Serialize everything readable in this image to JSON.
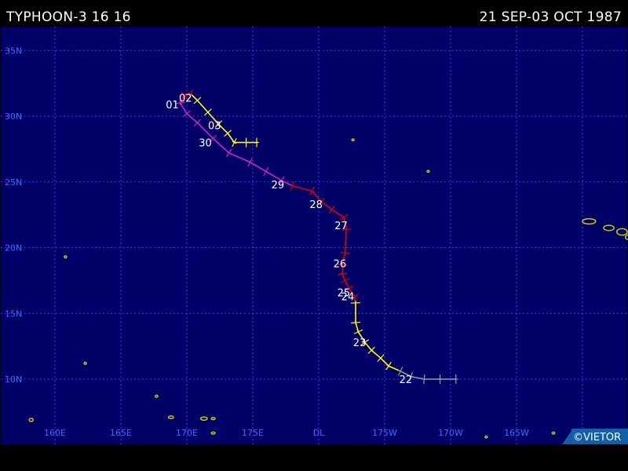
{
  "header": {
    "title": "TYPHOON-3 16 16",
    "dates": "21 SEP-03 OCT 1987"
  },
  "credit": "©VIETOR",
  "lat_labels": [
    {
      "lat": 35,
      "label": "35N"
    },
    {
      "lat": 30,
      "label": "30N"
    },
    {
      "lat": 25,
      "label": "25N"
    },
    {
      "lat": 20,
      "label": "20N"
    },
    {
      "lat": 15,
      "label": "15N"
    },
    {
      "lat": 10,
      "label": "10N"
    }
  ],
  "lon_labels": [
    {
      "lon": 160,
      "label": "160E"
    },
    {
      "lon": 165,
      "label": "165E"
    },
    {
      "lon": 170,
      "label": "170E"
    },
    {
      "lon": 175,
      "label": "175E"
    },
    {
      "lon": 180,
      "label": "DL"
    },
    {
      "lon": 185,
      "label": "175W"
    },
    {
      "lon": 190,
      "label": "170W"
    },
    {
      "lon": 195,
      "label": "165W"
    },
    {
      "lon": 200,
      "label": "160W"
    }
  ],
  "colors": {
    "ocean": "#000066",
    "grid": "#3a3aff",
    "axis_label": "#3b6dff",
    "depression": "#9a9a9a",
    "storm": "#ffff00",
    "typhoon": "#dd0000",
    "extratropical": "#cc22cc",
    "land": "#c8c800",
    "label": "#ffffff"
  },
  "track": [
    {
      "lat": 10.0,
      "lon": 190.4,
      "stage": "depression"
    },
    {
      "lat": 10.0,
      "lon": 189.2,
      "stage": "depression"
    },
    {
      "lat": 10.0,
      "lon": 188.0,
      "stage": "depression"
    },
    {
      "lat": 10.2,
      "lon": 187.0,
      "stage": "depression"
    },
    {
      "lat": 10.6,
      "lon": 186.2,
      "stage": "depression"
    },
    {
      "lat": 11.0,
      "lon": 185.3,
      "stage": "storm"
    },
    {
      "lat": 11.6,
      "lon": 184.7,
      "stage": "storm"
    },
    {
      "lat": 12.2,
      "lon": 184.0,
      "stage": "storm"
    },
    {
      "lat": 12.8,
      "lon": 183.5,
      "stage": "storm"
    },
    {
      "lat": 13.6,
      "lon": 183.0,
      "stage": "storm"
    },
    {
      "lat": 14.3,
      "lon": 182.8,
      "stage": "storm"
    },
    {
      "lat": 15.8,
      "lon": 182.8,
      "stage": "storm"
    },
    {
      "lat": 16.3,
      "lon": 182.7,
      "stage": "typhoon"
    },
    {
      "lat": 16.9,
      "lon": 182.3,
      "stage": "typhoon"
    },
    {
      "lat": 17.5,
      "lon": 182.0,
      "stage": "typhoon"
    },
    {
      "lat": 18.0,
      "lon": 181.8,
      "stage": "typhoon"
    },
    {
      "lat": 18.7,
      "lon": 181.8,
      "stage": "typhoon"
    },
    {
      "lat": 19.6,
      "lon": 182.0,
      "stage": "typhoon"
    },
    {
      "lat": 21.4,
      "lon": 182.1,
      "stage": "typhoon"
    },
    {
      "lat": 22.3,
      "lon": 181.9,
      "stage": "typhoon"
    },
    {
      "lat": 22.9,
      "lon": 181.0,
      "stage": "typhoon"
    },
    {
      "lat": 23.5,
      "lon": 180.2,
      "stage": "typhoon"
    },
    {
      "lat": 24.3,
      "lon": 179.5,
      "stage": "typhoon"
    },
    {
      "lat": 24.7,
      "lon": 178.0,
      "stage": "typhoon"
    },
    {
      "lat": 25.1,
      "lon": 177.2,
      "stage": "extratropical"
    },
    {
      "lat": 25.8,
      "lon": 176.0,
      "stage": "extratropical"
    },
    {
      "lat": 26.5,
      "lon": 174.8,
      "stage": "extratropical"
    },
    {
      "lat": 27.2,
      "lon": 173.2,
      "stage": "extratropical"
    },
    {
      "lat": 28.3,
      "lon": 172.0,
      "stage": "extratropical"
    },
    {
      "lat": 29.5,
      "lon": 170.8,
      "stage": "extratropical"
    },
    {
      "lat": 30.2,
      "lon": 170.0,
      "stage": "extratropical"
    },
    {
      "lat": 31.0,
      "lon": 169.5,
      "stage": "extratropical"
    },
    {
      "lat": 31.6,
      "lon": 169.8,
      "stage": "typhoon"
    },
    {
      "lat": 31.7,
      "lon": 170.3,
      "stage": "typhoon"
    },
    {
      "lat": 31.2,
      "lon": 170.8,
      "stage": "storm"
    },
    {
      "lat": 30.3,
      "lon": 171.6,
      "stage": "storm"
    },
    {
      "lat": 29.4,
      "lon": 172.4,
      "stage": "storm"
    },
    {
      "lat": 28.7,
      "lon": 173.1,
      "stage": "storm"
    },
    {
      "lat": 28.0,
      "lon": 173.6,
      "stage": "storm"
    },
    {
      "lat": 28.0,
      "lon": 174.5,
      "stage": "storm"
    },
    {
      "lat": 28.0,
      "lon": 175.3,
      "stage": "storm"
    }
  ],
  "day_labels": [
    {
      "label": "22",
      "lat": 10.0,
      "lon": 186.6
    },
    {
      "label": "23",
      "lat": 12.8,
      "lon": 183.1
    },
    {
      "label": "24",
      "lat": 16.3,
      "lon": 182.2
    },
    {
      "label": "25",
      "lat": 16.6,
      "lon": 181.9
    },
    {
      "label": "26",
      "lat": 18.8,
      "lon": 181.6
    },
    {
      "label": "27",
      "lat": 21.7,
      "lon": 181.7
    },
    {
      "label": "28",
      "lat": 23.3,
      "lon": 179.8
    },
    {
      "label": "29",
      "lat": 24.8,
      "lon": 176.9
    },
    {
      "label": "30",
      "lat": 28.0,
      "lon": 171.4
    },
    {
      "label": "01",
      "lat": 30.9,
      "lon": 168.9
    },
    {
      "label": "02",
      "lat": 31.4,
      "lon": 169.9
    },
    {
      "label": "03",
      "lat": 29.3,
      "lon": 172.1
    }
  ],
  "islands": [
    {
      "lat": 22.0,
      "lon": 200.5,
      "rx": 0.5,
      "ry": 0.2
    },
    {
      "lat": 21.5,
      "lon": 202.0,
      "rx": 0.4,
      "ry": 0.2
    },
    {
      "lat": 21.2,
      "lon": 203.0,
      "rx": 0.4,
      "ry": 0.25
    },
    {
      "lat": 20.8,
      "lon": 203.6,
      "rx": 0.35,
      "ry": 0.2
    },
    {
      "lat": 20.5,
      "lon": 204.3,
      "rx": 0.4,
      "ry": 0.3
    },
    {
      "lat": 19.6,
      "lon": 204.9,
      "rx": 0.6,
      "ry": 0.6
    },
    {
      "lat": 19.3,
      "lon": 160.8,
      "rx": 0.08,
      "ry": 0.08
    },
    {
      "lat": 11.2,
      "lon": 162.3,
      "rx": 0.08,
      "ry": 0.08
    },
    {
      "lat": 7.0,
      "lon": 171.3,
      "rx": 0.25,
      "ry": 0.12
    },
    {
      "lat": 7.1,
      "lon": 168.8,
      "rx": 0.2,
      "ry": 0.1
    },
    {
      "lat": 7.0,
      "lon": 172.0,
      "rx": 0.15,
      "ry": 0.08
    },
    {
      "lat": 5.9,
      "lon": 172.0,
      "rx": 0.15,
      "ry": 0.08
    },
    {
      "lat": 8.7,
      "lon": 167.7,
      "rx": 0.1,
      "ry": 0.08
    },
    {
      "lat": 6.9,
      "lon": 158.2,
      "rx": 0.15,
      "ry": 0.12
    },
    {
      "lat": 28.2,
      "lon": 182.6,
      "rx": 0.08,
      "ry": 0.06
    },
    {
      "lat": 25.8,
      "lon": 188.3,
      "rx": 0.08,
      "ry": 0.06
    },
    {
      "lat": 5.9,
      "lon": 197.8,
      "rx": 0.1,
      "ry": 0.08
    },
    {
      "lat": 5.6,
      "lon": 192.7,
      "rx": 0.08,
      "ry": 0.06
    }
  ]
}
